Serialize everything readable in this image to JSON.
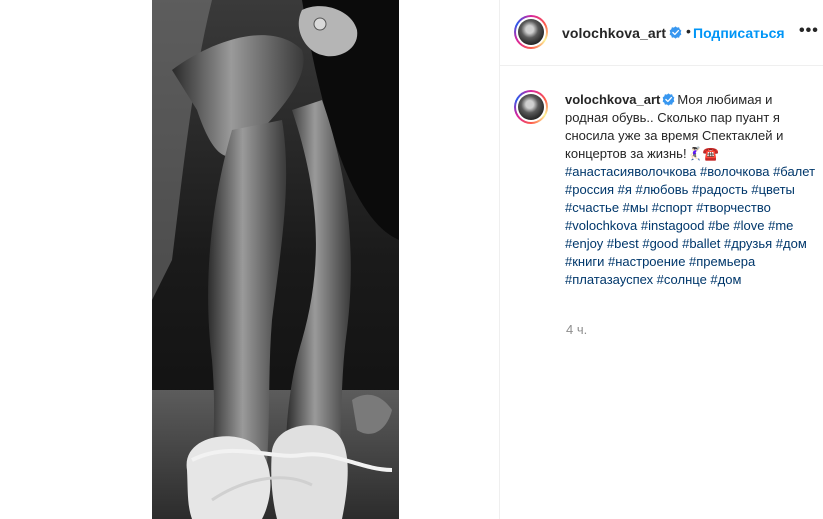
{
  "post": {
    "author": "volochkova_art",
    "follow_label": "Подписаться",
    "separator": "•",
    "more_label": "•••",
    "caption_text": "Моя любимая и родная обувь.. Сколько пар пуант я сносила уже за время Спектаклей и концертов за жизнь!🤾🏻‍♀️☎️",
    "hashtags": "#анастасияволочкова #волочкова #балет #россия #я #любовь #радость #цветы #счастье #мы #спорт #творчество #volochkova #instagood #be #love #me #enjoy #best #good #ballet #друзья #дом #книги #настроение #премьера #платазауспех #солнце #дом",
    "time": "4 ч."
  },
  "icons": {
    "verified": "verified-badge-icon",
    "more": "more-options-icon"
  },
  "colors": {
    "accent": "#0095f6",
    "hashtag": "#00376b",
    "muted": "#8e8e8e",
    "verified": "#3897f0"
  }
}
